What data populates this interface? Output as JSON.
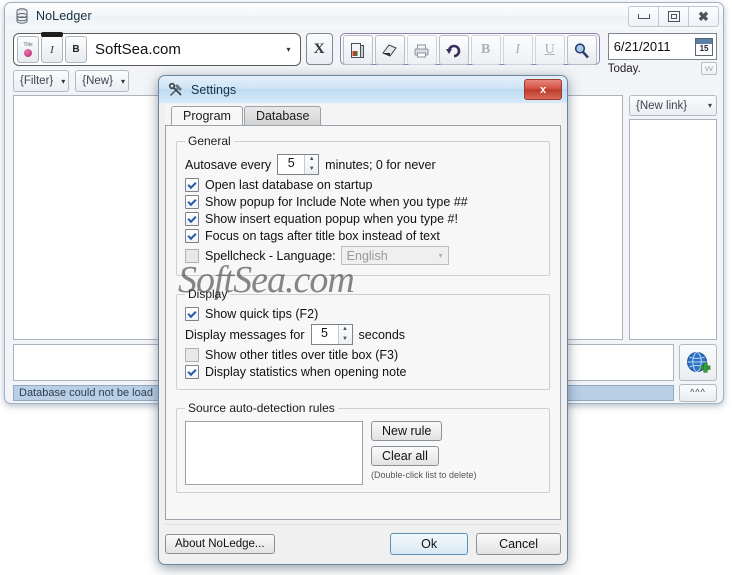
{
  "app": {
    "title": "NoLedger",
    "icon": "database-icon",
    "window_buttons": {
      "minimize": "minimize-icon",
      "maximize": "maximize-icon",
      "close": "close-icon"
    }
  },
  "toolbar": {
    "title_combo": {
      "value": "SoftSea.com",
      "dropdown": "▾"
    },
    "title_button_label": "Title",
    "italic_button_label": "I",
    "bold_button_label": "B",
    "x_button_label": "X",
    "buttons": [
      {
        "name": "open-note-icon",
        "glyph": "📔"
      },
      {
        "name": "save-note-icon",
        "glyph": "📕"
      },
      {
        "name": "print-icon",
        "glyph": "🖨"
      },
      {
        "name": "undo-icon",
        "glyph": "↶"
      },
      {
        "name": "bold-icon",
        "glyph": "B"
      },
      {
        "name": "italic-icon",
        "glyph": "I"
      },
      {
        "name": "underline-icon",
        "glyph": "U"
      },
      {
        "name": "search-icon",
        "glyph": "🔍"
      }
    ],
    "date": {
      "value": "6/21/2011",
      "calendar_day": "15",
      "today_label": "Today.",
      "vv_badge": "vv"
    }
  },
  "filter_row": {
    "filter_label": "{Filter}",
    "new_label": "{New}",
    "caret": "▾"
  },
  "right_pane": {
    "new_link_label": "{New link}",
    "caret": "▾"
  },
  "note_row": {
    "globe_icon": "globe-add-icon"
  },
  "status": {
    "message": "Database could not be load",
    "expand_label": "^^^"
  },
  "dialog": {
    "title": "Settings",
    "icon": "tools-icon",
    "close_label": "x",
    "tabs": [
      {
        "label": "Program",
        "active": true
      },
      {
        "label": "Database",
        "active": false
      }
    ],
    "general": {
      "legend": "General",
      "autosave_prefix": "Autosave every",
      "autosave_value": "5",
      "autosave_suffix": "minutes; 0 for never",
      "checkboxes": [
        {
          "label": "Open last database on startup",
          "checked": true
        },
        {
          "label": "Show popup for Include Note when you type ##",
          "checked": true
        },
        {
          "label": "Show insert equation popup when you type #!",
          "checked": true
        },
        {
          "label": "Focus on tags after title box instead of text",
          "checked": true
        }
      ],
      "spellcheck": {
        "label": "Spellcheck - Language:",
        "checked": false,
        "language_value": "English",
        "caret": "▾"
      }
    },
    "display": {
      "legend": "Display",
      "quick_tips": {
        "label": "Show quick tips (F2)",
        "checked": true
      },
      "messages_prefix": "Display messages for",
      "messages_value": "5",
      "messages_suffix": "seconds",
      "checkboxes": [
        {
          "label": "Show other titles over title box (F3)",
          "checked": false
        },
        {
          "label": "Display statistics when opening note",
          "checked": true
        }
      ]
    },
    "rules": {
      "legend": "Source auto-detection rules",
      "new_rule_label": "New rule",
      "clear_all_label": "Clear all",
      "hint": "(Double-click list to delete)",
      "items": []
    },
    "footer": {
      "about_label": "About NoLedge...",
      "ok_label": "Ok",
      "cancel_label": "Cancel"
    }
  },
  "watermark": {
    "text": "SoftSea.com"
  },
  "colors": {
    "accent_blue": "#b9cfe6",
    "dialog_title": "#cfe4f6",
    "close_red": "#c8402f",
    "toolbar_group_border": "#8f7fb5"
  }
}
